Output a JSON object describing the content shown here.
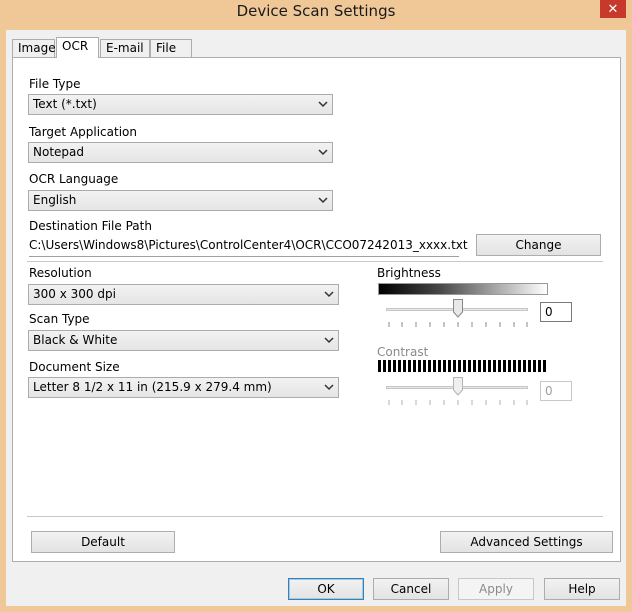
{
  "window": {
    "title": "Device Scan Settings",
    "close_glyph": "✕"
  },
  "tabs": [
    {
      "label": "Image",
      "active": false
    },
    {
      "label": "OCR",
      "active": true
    },
    {
      "label": "E-mail",
      "active": false
    },
    {
      "label": "File",
      "active": false
    }
  ],
  "file_type": {
    "label": "File Type",
    "value": "Text (*.txt)"
  },
  "target_application": {
    "label": "Target Application",
    "value": "Notepad"
  },
  "ocr_language": {
    "label": "OCR Language",
    "value": "English"
  },
  "destination": {
    "label": "Destination File Path",
    "value": "C:\\Users\\Windows8\\Pictures\\ControlCenter4\\OCR\\CCO07242013_xxxx.txt",
    "change_label": "Change"
  },
  "resolution": {
    "label": "Resolution",
    "value": "300 x 300 dpi"
  },
  "scan_type": {
    "label": "Scan Type",
    "value": "Black & White"
  },
  "document_size": {
    "label": "Document Size",
    "value": "Letter 8 1/2 x 11 in (215.9 x 279.4 mm)"
  },
  "brightness": {
    "label": "Brightness",
    "value": "0",
    "enabled": true
  },
  "contrast": {
    "label": "Contrast",
    "value": "0",
    "enabled": false
  },
  "buttons": {
    "default": "Default",
    "advanced": "Advanced Settings",
    "ok": "OK",
    "cancel": "Cancel",
    "apply": "Apply",
    "help": "Help"
  },
  "colors": {
    "frame": "#f0c897",
    "close": "#c7392b",
    "focus_border": "#3c7fb1"
  },
  "icons": {
    "close": "close-icon",
    "dropdown": "chevron-down-icon",
    "slider_thumb": "slider-thumb"
  }
}
